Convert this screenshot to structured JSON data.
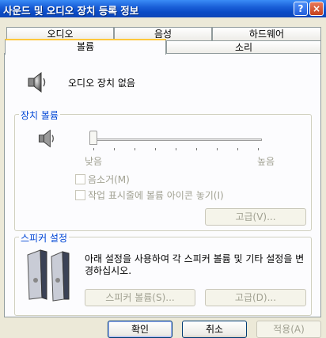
{
  "window": {
    "title": "사운드 및 오디오 장치 등록 정보"
  },
  "titlebar": {
    "help_glyph": "?",
    "close_glyph": "×"
  },
  "tabs_row1": [
    "오디오",
    "음성",
    "하드웨어"
  ],
  "tabs_row2": [
    "볼륨",
    "소리"
  ],
  "selected_tab": "볼륨",
  "device": {
    "name": "오디오 장치 없음"
  },
  "device_volume": {
    "title": "장치 볼륨",
    "slider_low": "낮음",
    "slider_high": "높음",
    "slider_value": 0,
    "mute_label": "음소거(M)",
    "tray_icon_label": "작업 표시줄에 볼륨 아이콘 놓기(I)",
    "advanced_label": "고급(V)..."
  },
  "speaker_settings": {
    "title": "스피커 설정",
    "description": "아래 설정을 사용하여 각 스피커 볼륨 및 기타 설정을 변경하십시오.",
    "speaker_volume_label": "스피커 볼륨(S)...",
    "advanced_label": "고급(D)..."
  },
  "footer": {
    "ok_label": "확인",
    "cancel_label": "취소",
    "apply_label": "적용(A)"
  },
  "colors": {
    "group_title": "#0046d5",
    "title_bar": "#0a4bc6",
    "selected_tab_accent": "#ffc83c"
  }
}
